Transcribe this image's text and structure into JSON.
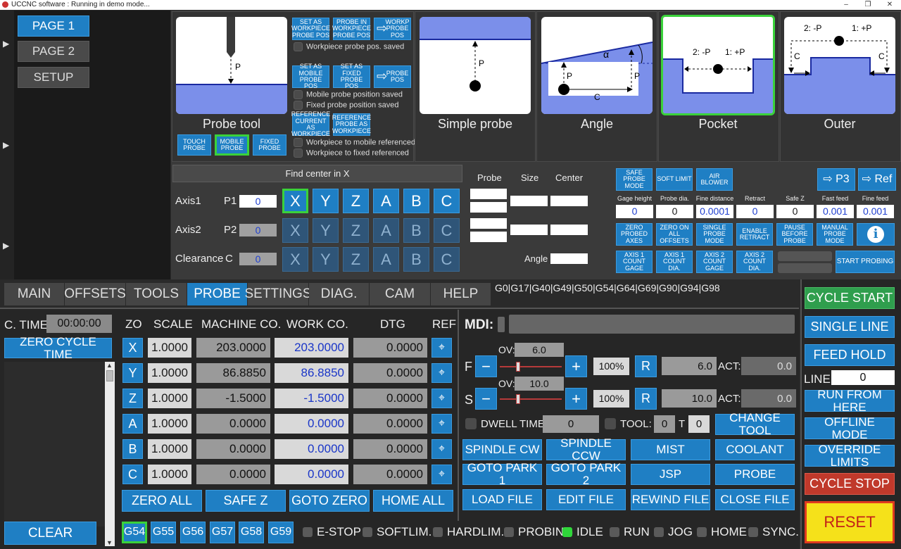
{
  "title": "UCCNC software : Running in demo mode...",
  "window_buttons": [
    "–",
    "❐",
    "✕"
  ],
  "pages": [
    "PAGE 1",
    "PAGE 2",
    "SETUP"
  ],
  "probe": {
    "probe_tool_label": "Probe tool",
    "probe_tool_buttons": [
      "TOUCH PROBE",
      "MOBILE PROBE",
      "FIXED PROBE"
    ],
    "wp_buttons": [
      "SET AS WORKPIECE PROBE POS",
      "PROBE IN WORKPIECE PROBE POS",
      "WORKP PROBE POS"
    ],
    "wp_status": "Workpiece probe pos. saved",
    "mobile_buttons": [
      "SET AS MOBILE PROBE POS",
      "SET AS FIXED PROBE POS",
      "PROBE POS"
    ],
    "mobile_status": "Mobile probe position saved",
    "fixed_status": "Fixed probe position saved",
    "ref_buttons": [
      "REFERENCE CURRENT AS WORKPIECE",
      "REFERENCE PROBE AS WORKPIECE"
    ],
    "ref_mobile_status": "Workpiece to mobile referenced",
    "ref_fixed_status": "Workpiece to fixed referenced",
    "pic_p": "P",
    "modes": [
      "Simple probe",
      "Angle",
      "Pocket",
      "Outer"
    ],
    "angle_labels": {
      "p1": "P",
      "p2": "P",
      "c": "C",
      "alpha": "α"
    },
    "pocket_labels": {
      "left": "2: -P",
      "right": "1: +P"
    },
    "outer_labels": {
      "left": "2: -P",
      "right": "1: +P",
      "c1": "C",
      "c2": "C"
    },
    "find_center": "Find center in X",
    "axis_rows": [
      {
        "label": "Axis1",
        "p": "P1",
        "value": "0"
      },
      {
        "label": "Axis2",
        "p": "P2",
        "value": "0"
      },
      {
        "label": "Clearance",
        "p": "C",
        "value": "0"
      }
    ],
    "axis_letters": [
      "X",
      "Y",
      "Z",
      "A",
      "B",
      "C"
    ],
    "result_headers": [
      "Probe",
      "Size",
      "Center"
    ],
    "angle_label": "Angle",
    "top_buttons": [
      "SAFE PROBE MODE",
      "SOFT LIMIT",
      "AIR BLOWER"
    ],
    "p3_button": "⇨ P3",
    "ref_button": "⇨ Ref",
    "params": [
      {
        "label": "Gage height",
        "value": "0"
      },
      {
        "label": "Probe dia.",
        "value": "0"
      },
      {
        "label": "Fine distance",
        "value": "0.0001"
      },
      {
        "label": "Retract",
        "value": "0"
      },
      {
        "label": "Safe Z",
        "value": "0"
      },
      {
        "label": "Fast feed",
        "value": "0.001"
      },
      {
        "label": "Fine feed",
        "value": "0.001"
      }
    ],
    "option_buttons": [
      "ZERO PROBED AXES",
      "ZERO ON ALL OFFSETS",
      "SINGLE PROBE MODE",
      "ENABLE RETRACT",
      "PAUSE BEFORE PROBE",
      "MANUAL PROBE MODE"
    ],
    "info_icon": "i",
    "count_buttons": [
      "AXIS 1 COUNT GAGE",
      "AXIS 1 COUNT DIA.",
      "AXIS 2 COUNT GAGE",
      "AXIS 2 COUNT DIA."
    ],
    "start_probing": "START PROBING"
  },
  "tabs": [
    "MAIN",
    "OFFSETS",
    "TOOLS",
    "PROBE",
    "SETTINGS",
    "DIAG.",
    "CAM",
    "HELP"
  ],
  "gcode_modes": "G0|G17|G40|G49|G50|G54|G64|G69|G90|G94|G98",
  "ctime": {
    "label": "C. TIME:",
    "value": "00:00:00",
    "zero_button": "ZERO CYCLE TIME",
    "clear_button": "CLEAR"
  },
  "dro_headers": [
    "ZO",
    "SCALE",
    "MACHINE CO.",
    "WORK CO.",
    "DTG",
    "REF"
  ],
  "dro": [
    {
      "axis": "X",
      "scale": "1.0000",
      "machine": "203.0000",
      "work": "203.0000",
      "dtg": "0.0000"
    },
    {
      "axis": "Y",
      "scale": "1.0000",
      "machine": "86.8850",
      "work": "86.8850",
      "dtg": "0.0000"
    },
    {
      "axis": "Z",
      "scale": "1.0000",
      "machine": "-1.5000",
      "work": "-1.5000",
      "dtg": "0.0000"
    },
    {
      "axis": "A",
      "scale": "1.0000",
      "machine": "0.0000",
      "work": "0.0000",
      "dtg": "0.0000"
    },
    {
      "axis": "B",
      "scale": "1.0000",
      "machine": "0.0000",
      "work": "0.0000",
      "dtg": "0.0000"
    },
    {
      "axis": "C",
      "scale": "1.0000",
      "machine": "0.0000",
      "work": "0.0000",
      "dtg": "0.0000"
    }
  ],
  "dro_buttons": [
    "ZERO ALL",
    "SAFE Z",
    "GOTO ZERO",
    "HOME ALL"
  ],
  "fixtures": [
    "G54",
    "G55",
    "G56",
    "G57",
    "G58",
    "G59"
  ],
  "mdi_label": "MDI:",
  "feed": {
    "letter": "F",
    "ov_label": "OV:",
    "ov": "6.0",
    "percent": "100%",
    "reset": "R",
    "value": "6.0",
    "act_label": "ACT:",
    "act": "0.0",
    "override_fraction": 0.3
  },
  "spindle": {
    "letter": "S",
    "ov_label": "OV:",
    "ov": "10.0",
    "percent": "100%",
    "reset": "R",
    "value": "10.0",
    "act_label": "ACT:",
    "act": "0.0",
    "override_fraction": 0.3
  },
  "dwell": {
    "label": "DWELL TIME:",
    "value": "0",
    "tool_label": "TOOL:",
    "tool": "0",
    "t_label": "T",
    "t": "0",
    "change_tool": "CHANGE TOOL"
  },
  "action_buttons": [
    "SPINDLE CW",
    "SPINDLE CCW",
    "MIST",
    "COOLANT",
    "GOTO PARK 1",
    "GOTO PARK 2",
    "JSP",
    "PROBE",
    "LOAD FILE",
    "EDIT FILE",
    "REWIND FILE",
    "CLOSE FILE"
  ],
  "status_leds": [
    {
      "label": "E-STOP",
      "on": false
    },
    {
      "label": "SOFTLIM.",
      "on": false
    },
    {
      "label": "HARDLIM.",
      "on": false
    },
    {
      "label": "PROBING",
      "on": false
    },
    {
      "label": "IDLE",
      "on": true
    },
    {
      "label": "RUN",
      "on": false
    },
    {
      "label": "JOG",
      "on": false
    },
    {
      "label": "HOME",
      "on": false
    },
    {
      "label": "SYNC.",
      "on": false
    }
  ],
  "right_buttons": {
    "cycle_start": "CYCLE START",
    "single_line": "SINGLE LINE",
    "feed_hold": "FEED HOLD",
    "line_label": "LINE:",
    "line_value": "0",
    "run_from_here": "RUN FROM HERE",
    "offline_mode": "OFFLINE MODE",
    "override_limits": "OVERRIDE LIMITS",
    "cycle_stop": "CYCLE STOP",
    "reset": "RESET"
  },
  "colors": {
    "accent": "#1f7fc4",
    "selected": "#3ad23a",
    "probe_blue": "#7b8fea",
    "background": "#2a2a2a"
  }
}
